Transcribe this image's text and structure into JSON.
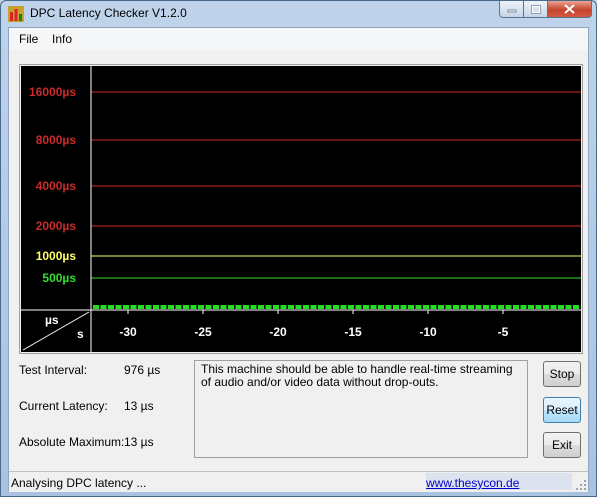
{
  "window": {
    "title": "DPC Latency Checker V1.2.0"
  },
  "menu": [
    "File",
    "Info"
  ],
  "graph": {
    "y_ticks": [
      {
        "label": "16000µs",
        "color": "#cc2a2a"
      },
      {
        "label": "8000µs",
        "color": "#cc2a2a"
      },
      {
        "label": "4000µs",
        "color": "#cc2a2a"
      },
      {
        "label": "2000µs",
        "color": "#cc2a2a"
      },
      {
        "label": "1000µs",
        "color": "#ffff66"
      },
      {
        "label": "500µs",
        "color": "#33dd33"
      }
    ],
    "corner_y_unit": "µs",
    "corner_x_unit": "s",
    "x_ticks": [
      "-30",
      "-25",
      "-20",
      "-15",
      "-10",
      "-5"
    ],
    "bar_color": "#22dd22"
  },
  "stats": {
    "test_interval_label": "Test Interval:",
    "test_interval_value": "976 µs",
    "current_latency_label": "Current Latency:",
    "current_latency_value": "13 µs",
    "absolute_max_label": "Absolute Maximum:",
    "absolute_max_value": "13 µs"
  },
  "message": "This machine should be able to handle real-time streaming of audio and/or video data without drop-outs.",
  "buttons": {
    "stop": "Stop",
    "reset": "Reset",
    "exit": "Exit"
  },
  "status": {
    "text": "Analysing DPC latency ...",
    "link": "www.thesycon.de"
  }
}
